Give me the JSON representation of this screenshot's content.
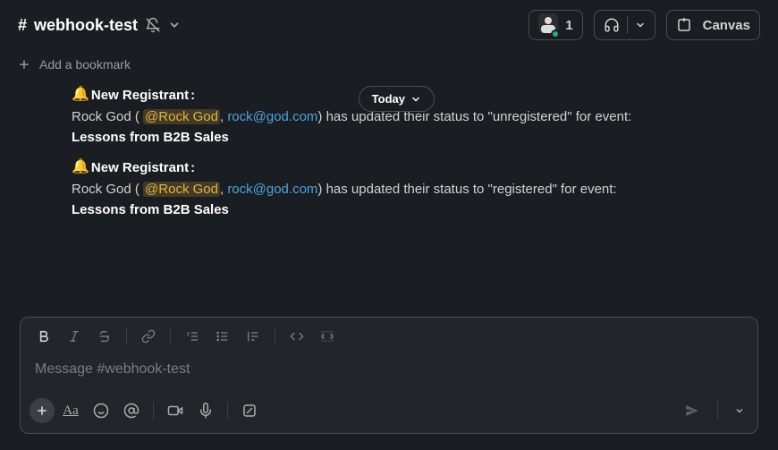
{
  "header": {
    "channel_name": "webhook-test",
    "member_count": "1",
    "canvas_label": "Canvas"
  },
  "bookmarks": {
    "add_label": "Add a bookmark"
  },
  "date_divider": {
    "label": "Today"
  },
  "messages": [
    {
      "bell": "🔔",
      "headline": "New Registrant",
      "colon": ":",
      "person_name": "Rock God",
      "open_paren": " ( ",
      "mention": "@Rock God",
      "comma_sep": ", ",
      "email": "rock@god.com",
      "after_email": ") has updated their status to \"unregistered\" for event: ",
      "event_name": "Lessons from B2B Sales"
    },
    {
      "bell": "🔔",
      "headline": "New Registrant",
      "colon": ":",
      "person_name": "Rock God",
      "open_paren": " ( ",
      "mention": "@Rock God",
      "comma_sep": ", ",
      "email": "rock@god.com",
      "after_email": ") has updated their status to \"registered\" for event: ",
      "event_name": "Lessons from B2B Sales"
    }
  ],
  "composer": {
    "placeholder": "Message #webhook-test"
  },
  "colors": {
    "mention_bg": "rgba(242,199,68,0.18)",
    "mention_fg": "#e8b339",
    "link": "#4aa3e0"
  }
}
